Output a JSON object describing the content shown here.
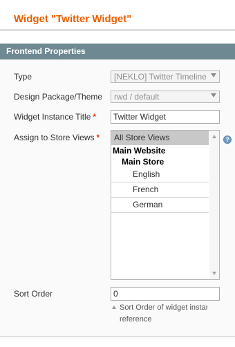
{
  "page": {
    "title": "Widget \"Twitter Widget\""
  },
  "fieldset": {
    "title": "Frontend Properties"
  },
  "fields": {
    "type": {
      "label": "Type",
      "value": "[NEKLO] Twitter Timeline"
    },
    "design_package": {
      "label": "Design Package/Theme",
      "value": "rwd / default"
    },
    "instance_title": {
      "label": "Widget Instance Title",
      "required_mark": "*",
      "value": "Twitter Widget"
    },
    "store_views": {
      "label": "Assign to Store Views",
      "required_mark": "*",
      "options": {
        "all": "All Store Views",
        "website": "Main Website",
        "store": "Main Store",
        "english": "English",
        "french": "French",
        "german": "German"
      },
      "help_icon": "help-icon"
    },
    "sort_order": {
      "label": "Sort Order",
      "value": "0",
      "note_line1": "Sort Order of widget instance",
      "note_line2": "reference"
    }
  },
  "colors": {
    "title": "#eb5e00",
    "fieldset_bar": "#6f8992",
    "required": "#eb340a",
    "selected_option": "#c8c8c8"
  }
}
